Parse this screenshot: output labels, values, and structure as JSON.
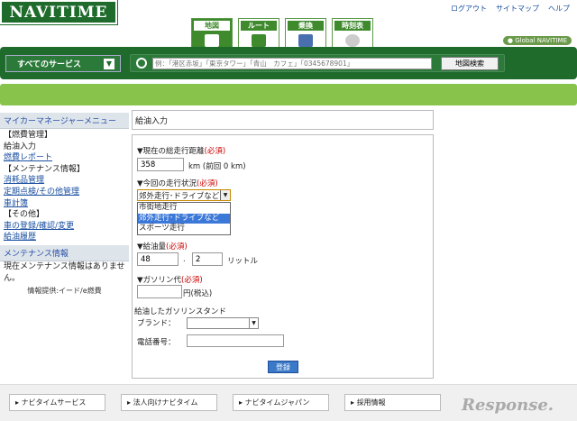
{
  "header": {
    "logo": "NAVITIME",
    "links": [
      "ログアウト",
      "サイトマップ",
      "ヘルプ"
    ],
    "global_badge": "Global NAVITIME"
  },
  "tabs": [
    {
      "label": "地図",
      "active": true
    },
    {
      "label": "ルート",
      "active": false
    },
    {
      "label": "乗換",
      "active": false
    },
    {
      "label": "時刻表",
      "active": false
    }
  ],
  "nav": {
    "all_services": "すべてのサービス",
    "search_placeholder": "例：「港区赤坂」「東京タワー」「青山　カフェ」「0345678901」",
    "search_button": "地図検索"
  },
  "sidebar": {
    "menu_title": "マイカーマネージャーメニュー",
    "items": [
      {
        "text": "【燃費管理】",
        "link": false
      },
      {
        "text": "給油入力",
        "link": false
      },
      {
        "text": "燃費レポート",
        "link": true
      },
      {
        "text": "【メンテナンス情報】",
        "link": false
      },
      {
        "text": "消耗品管理",
        "link": true
      },
      {
        "text": "定期点検/その他管理",
        "link": true
      },
      {
        "text": "車計簿",
        "link": true
      },
      {
        "text": "【その他】",
        "link": false
      },
      {
        "text": "車の登録/確認/変更",
        "link": true
      },
      {
        "text": "給油履歴",
        "link": true
      }
    ],
    "maint_title": "メンテナンス情報",
    "maint_text": "現在メンテナンス情報はありません。",
    "credit": "情報提供:イード/e燃費"
  },
  "form": {
    "title": "給油入力",
    "odometer_label": "▼現在の総走行距離",
    "required": "(必須)",
    "odometer_value": "358",
    "odometer_unit": "km (前回 0 km)",
    "driving_label": "▼今回の走行状況",
    "driving_selected": "郊外走行･ドライブなど",
    "driving_options": [
      "市街地走行",
      "郊外走行･ドライブなど",
      "スポーツ走行"
    ],
    "fuel_label": "▼給油量",
    "fuel_int": "48",
    "fuel_dot": ".",
    "fuel_dec": "2",
    "fuel_unit": "リットル",
    "price_label": "▼ガソリン代",
    "price_unit": "円(税込)",
    "station_label": "給油したガソリンスタンド",
    "brand_label": "ブランド：",
    "phone_label": "電話番号：",
    "register_button": "登録"
  },
  "footer": {
    "columns": [
      "ナビタイムサービス",
      "法人向けナビタイム",
      "ナビタイムジャパン",
      "採用情報"
    ],
    "brand": "Response."
  }
}
